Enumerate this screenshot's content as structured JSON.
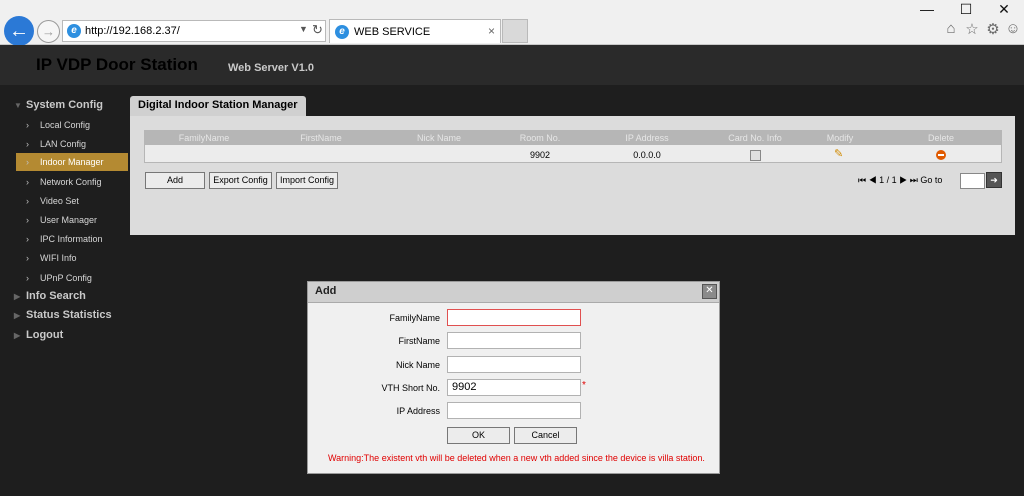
{
  "browser": {
    "url": "http://192.168.2.37/",
    "tab_title": "WEB SERVICE",
    "tab_close": "×"
  },
  "window": {
    "minimize": "—",
    "maximize": "☐",
    "close": "✕"
  },
  "app": {
    "title": "IP VDP Door Station",
    "version": "Web Server V1.0"
  },
  "sidebar": {
    "system_config": "System Config",
    "items": [
      {
        "label": "Local Config"
      },
      {
        "label": "LAN Config"
      },
      {
        "label": "Indoor Manager"
      },
      {
        "label": "Network Config"
      },
      {
        "label": "Video Set"
      },
      {
        "label": "User Manager"
      },
      {
        "label": "IPC Information"
      },
      {
        "label": "WIFI Info"
      },
      {
        "label": "UPnP Config"
      }
    ],
    "info_search": "Info Search",
    "status_statistics": "Status Statistics",
    "logout": "Logout"
  },
  "panel": {
    "tab": "Digital Indoor Station Manager",
    "columns": [
      "FamilyName",
      "FirstName",
      "Nick Name",
      "Room No.",
      "IP Address",
      "Card No. Info",
      "Modify",
      "Delete"
    ],
    "row": {
      "room_no": "9902",
      "ip": "0.0.0.0"
    },
    "buttons": {
      "add": "Add",
      "export": "Export Config",
      "import": "Import Config"
    },
    "pager": {
      "page": "1 / 1",
      "goto": "Go to"
    }
  },
  "dialog": {
    "title": "Add",
    "close": "✕",
    "fields": {
      "family_name": {
        "label": "FamilyName",
        "value": ""
      },
      "first_name": {
        "label": "FirstName",
        "value": ""
      },
      "nick_name": {
        "label": "Nick Name",
        "value": ""
      },
      "vth_short_no": {
        "label": "VTH Short No.",
        "value": "9902",
        "required": "*"
      },
      "ip_address": {
        "label": "IP Address",
        "value": ""
      }
    },
    "ok": "OK",
    "cancel": "Cancel",
    "warning": "Warning:The existent vth will be deleted when a new vth added since the device is villa station."
  },
  "colors": {
    "accent": "#b48a32",
    "required": "#e00000",
    "focus_border": "#e05050"
  }
}
